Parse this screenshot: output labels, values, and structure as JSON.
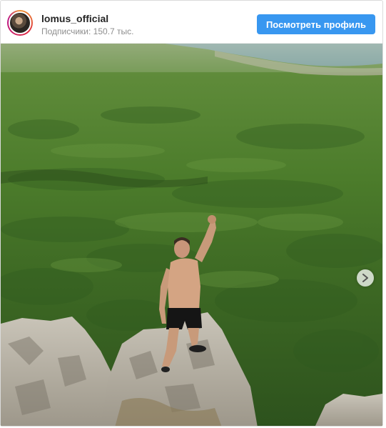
{
  "post": {
    "username": "lomus_official",
    "followers": "Подписчики: 150.7 тыс.",
    "view_profile_label": "Посмотреть профиль"
  },
  "icons": {
    "avatar": "profile-avatar",
    "next": "chevron-right-icon"
  },
  "colors": {
    "button": "#3897f0",
    "username": "#262626",
    "secondary_text": "#8e8e8e",
    "forest": "#4f7a33",
    "sea": "#7fa3b5"
  }
}
